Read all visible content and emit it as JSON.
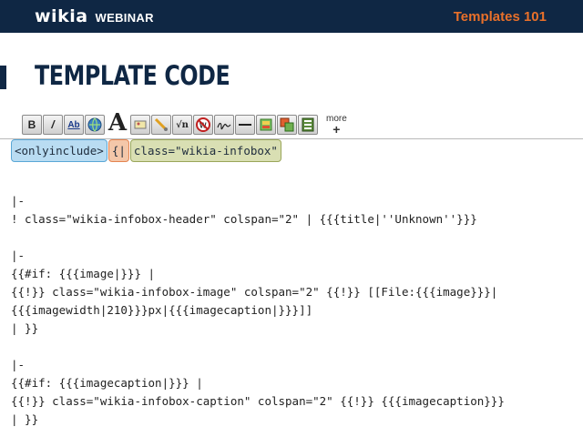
{
  "header": {
    "brand": "wikia",
    "subtitle": "WEBINAR",
    "course": "Templates 101"
  },
  "slide": {
    "title": "TEMPLATE CODE"
  },
  "toolbar": {
    "buttons": [
      {
        "name": "bold-icon",
        "glyph": "B"
      },
      {
        "name": "italic-icon",
        "glyph": "/"
      },
      {
        "name": "link-icon",
        "glyph": "Ab"
      },
      {
        "name": "globe-link-icon",
        "glyph": ""
      },
      {
        "name": "big-a-icon",
        "glyph": "A"
      },
      {
        "name": "image-icon",
        "glyph": ""
      },
      {
        "name": "media-icon",
        "glyph": ""
      },
      {
        "name": "math-icon",
        "glyph": "√n"
      },
      {
        "name": "nowiki-icon",
        "glyph": ""
      },
      {
        "name": "signature-icon",
        "glyph": ""
      },
      {
        "name": "horizontal-line-icon",
        "glyph": ""
      },
      {
        "name": "gallery-icon",
        "glyph": ""
      },
      {
        "name": "table-icon",
        "glyph": ""
      },
      {
        "name": "template-icon",
        "glyph": ""
      }
    ],
    "more_label": "more",
    "more_plus": "+"
  },
  "editor": {
    "highlight": {
      "onlyinclude": "<onlyinclude>",
      "table_open": "{|",
      "class_attr": "class=\"wikia-infobox\""
    },
    "lines": [
      "",
      "|-",
      "! class=\"wikia-infobox-header\" colspan=\"2\" | {{{title|''Unknown''}}}",
      "",
      "|-",
      "{{#if: {{{image|}}} |",
      "{{!}} class=\"wikia-infobox-image\" colspan=\"2\" {{!}} [[File:{{{image}}}|",
      "{{{imagewidth|210}}}px|{{{imagecaption|}}}]]",
      "| }}",
      "",
      "|-",
      "{{#if: {{{imagecaption|}}} |",
      "{{!}} class=\"wikia-infobox-caption\" colspan=\"2\" {{!}} {{{imagecaption}}}",
      "| }}"
    ]
  },
  "colors": {
    "navy": "#0f2744",
    "accent_orange": "#e8702a"
  }
}
